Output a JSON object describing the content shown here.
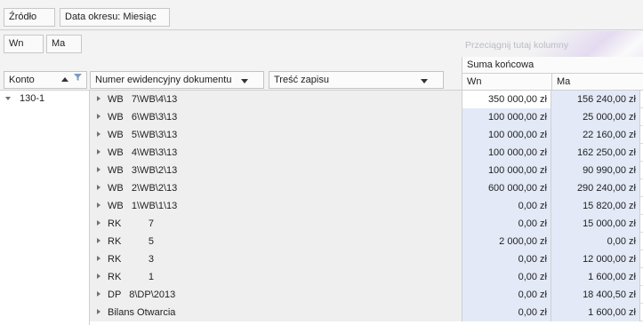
{
  "filters": {
    "source": "Źródło",
    "period": "Data okresu: Miesiąc"
  },
  "data_area": {
    "wn": "Wn",
    "ma": "Ma",
    "drop_hint": "Przeciągnij tutaj kolumny"
  },
  "headers": {
    "konto": "Konto",
    "document": "Numer ewidencyjny dokumentu",
    "tresc": "Treść zapisu",
    "suma": "Suma końcowa",
    "wn": "Wn",
    "ma": "Ma"
  },
  "account": "130-1",
  "rows": [
    {
      "doc": "WB   7\\WB\\4\\13",
      "wn": "350 000,00 zł",
      "ma": "156 240,00 zł"
    },
    {
      "doc": "WB   6\\WB\\3\\13",
      "wn": "100 000,00 zł",
      "ma": "25 000,00 zł"
    },
    {
      "doc": "WB   5\\WB\\3\\13",
      "wn": "100 000,00 zł",
      "ma": "22 160,00 zł"
    },
    {
      "doc": "WB   4\\WB\\3\\13",
      "wn": "100 000,00 zł",
      "ma": "162 250,00 zł"
    },
    {
      "doc": "WB   3\\WB\\2\\13",
      "wn": "100 000,00 zł",
      "ma": "90 990,00 zł"
    },
    {
      "doc": "WB   2\\WB\\2\\13",
      "wn": "600 000,00 zł",
      "ma": "290 240,00 zł"
    },
    {
      "doc": "WB   1\\WB\\1\\13",
      "wn": "0,00 zł",
      "ma": "15 820,00 zł"
    },
    {
      "doc": "RK          7",
      "wn": "0,00 zł",
      "ma": "15 000,00 zł"
    },
    {
      "doc": "RK          5",
      "wn": "2 000,00 zł",
      "ma": "0,00 zł"
    },
    {
      "doc": "RK          3",
      "wn": "0,00 zł",
      "ma": "12 000,00 zł"
    },
    {
      "doc": "RK          1",
      "wn": "0,00 zł",
      "ma": "1 600,00 zł"
    },
    {
      "doc": "DP   8\\DP\\2013",
      "wn": "0,00 zł",
      "ma": "18 400,50 zł"
    },
    {
      "doc": "Bilans Otwarcia",
      "wn": "0,00 zł",
      "ma": "1 600,00 zł"
    }
  ],
  "colors": {
    "data_cell": "#e3e9f7",
    "doc_cell": "#efefef",
    "toolbar": "#f3f3f3"
  }
}
